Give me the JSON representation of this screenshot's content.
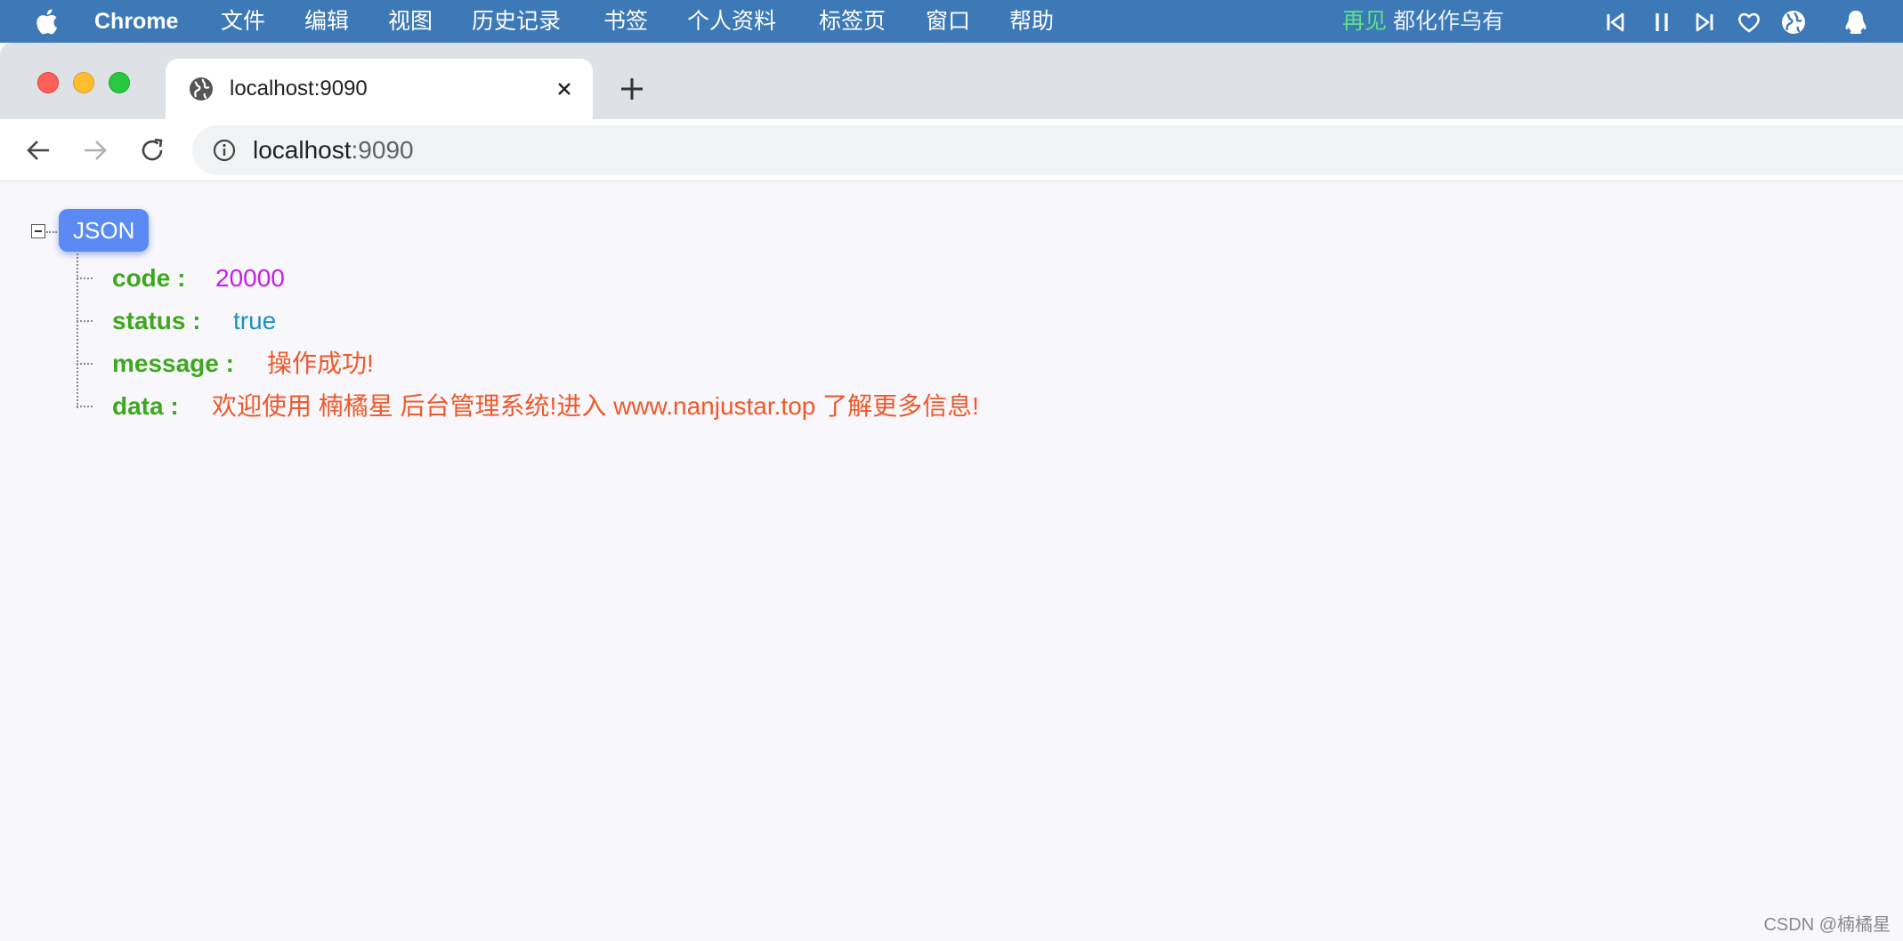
{
  "menubar": {
    "app_name": "Chrome",
    "items": [
      "文件",
      "编辑",
      "视图",
      "历史记录",
      "书签",
      "个人资料",
      "标签页",
      "窗口",
      "帮助"
    ],
    "now_playing": {
      "song": "再见",
      "artist": "都化作乌有"
    },
    "icons": [
      "apple-icon",
      "previous-track-icon",
      "pause-icon",
      "next-track-icon",
      "heart-icon",
      "globe-icon",
      "qq-penguin-icon"
    ],
    "colors": {
      "background": "#3d79b6",
      "song": "#5be08a"
    }
  },
  "browser": {
    "tab": {
      "title": "localhost:9090"
    },
    "address": {
      "host": "localhost",
      "port": ":9090"
    }
  },
  "json_viewer": {
    "root_label": "JSON",
    "entries": [
      {
        "key": "code :",
        "value": "20000",
        "type": "number"
      },
      {
        "key": "status :",
        "value": "true",
        "type": "boolean"
      },
      {
        "key": "message :",
        "value": "操作成功!",
        "type": "string"
      },
      {
        "key": "data :",
        "value": "欢迎使用 楠橘星 后台管理系统!进入 www.nanjustar.top 了解更多信息!",
        "type": "string"
      }
    ],
    "colors": {
      "key": "#3da81e",
      "number": "#c41ee6",
      "boolean": "#1e8fc6",
      "string": "#f0582a",
      "badge": "#5b8af5"
    }
  },
  "watermark": "CSDN @楠橘星"
}
